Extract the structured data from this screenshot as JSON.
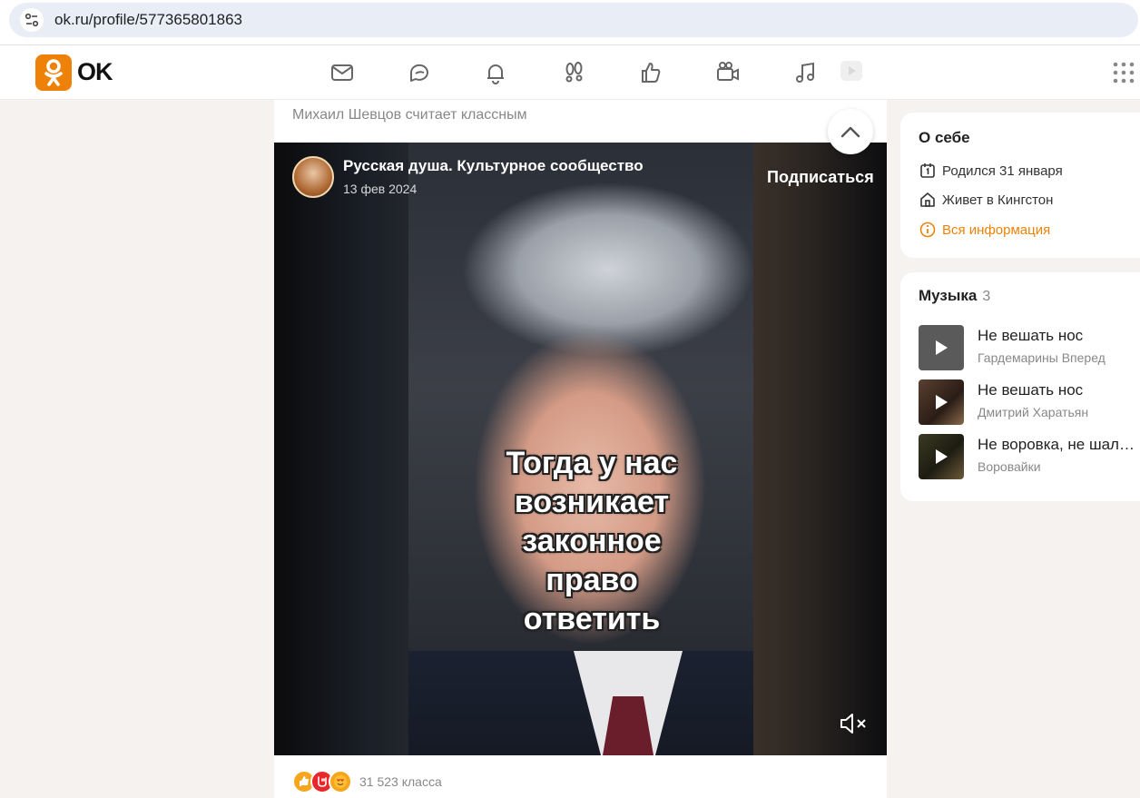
{
  "browser": {
    "url": "ok.ru/profile/577365801863"
  },
  "header": {
    "logo_text": "OK",
    "nav": [
      {
        "name": "messages-icon"
      },
      {
        "name": "discussions-icon"
      },
      {
        "name": "notifications-icon"
      },
      {
        "name": "guests-icon"
      },
      {
        "name": "marks-icon"
      },
      {
        "name": "video-icon"
      },
      {
        "name": "music-icon"
      },
      {
        "name": "games-icon"
      }
    ],
    "accent_color": "#ee8208"
  },
  "feed": {
    "liked_by": "Михаил Шевцов считает классным",
    "post": {
      "channel_name": "Русская душа. Культурное сообщество",
      "date": "13 фев 2024",
      "subscribe_label": "Подписаться",
      "subtitle_lines": [
        "Тогда у нас",
        "возникает",
        "законное",
        "право",
        "ответить"
      ],
      "reactions_count": "31 523 класса"
    }
  },
  "about": {
    "title": "О себе",
    "birthday": "Родился 31 января",
    "lives": "Живет в Кингстон",
    "all_info_link": "Вся информация"
  },
  "music": {
    "title": "Музыка",
    "count": "3",
    "tracks": [
      {
        "name": "Не вешать нос",
        "artist": "Гардемарины Вперед"
      },
      {
        "name": "Не вешать нос",
        "artist": "Дмитрий Харатьян"
      },
      {
        "name": "Не воровка, не шалава",
        "artist": "Воровайки"
      }
    ]
  }
}
